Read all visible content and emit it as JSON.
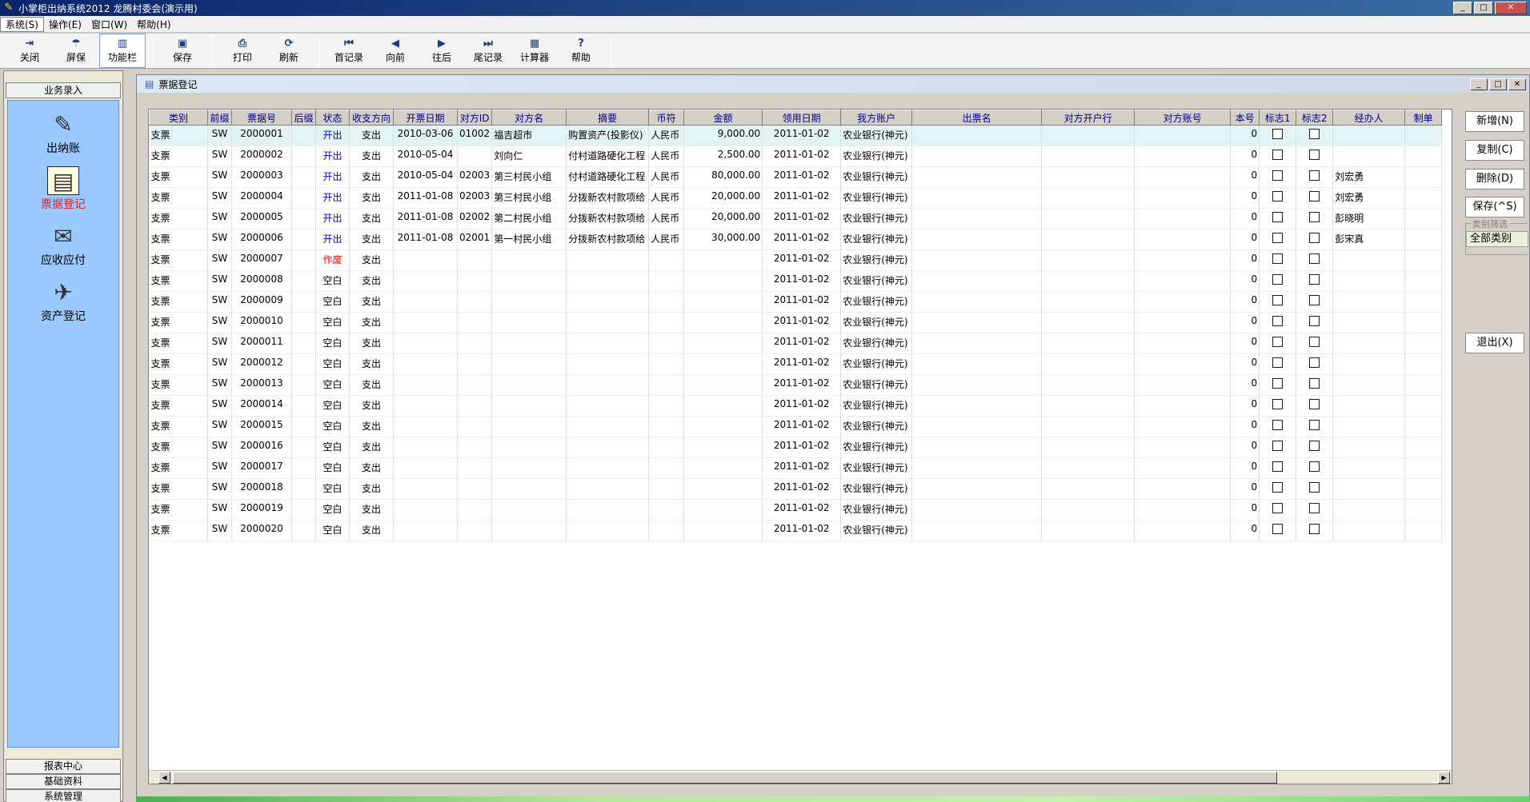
{
  "window": {
    "title": "小掌柜出纳系统2012  龙腾村委会(演示用)",
    "min": "_",
    "max": "□",
    "close": "✕"
  },
  "menu": [
    "系统(S)",
    "操作(E)",
    "窗口(W)",
    "帮助(H)"
  ],
  "toolbar": [
    {
      "label": "关闭",
      "icon": "door-exit-icon",
      "glyph": "⇥"
    },
    {
      "label": "屏保",
      "icon": "umbrella-icon",
      "glyph": "☂"
    },
    {
      "label": "功能栏",
      "icon": "panel-icon",
      "glyph": "▥"
    },
    {
      "label": "保存",
      "icon": "floppy-icon",
      "glyph": "▣"
    },
    {
      "label": "打印",
      "icon": "printer-icon",
      "glyph": "⎙"
    },
    {
      "label": "刷新",
      "icon": "refresh-icon",
      "glyph": "⟳"
    },
    {
      "label": "首记录",
      "icon": "first-record-icon",
      "glyph": "⏮"
    },
    {
      "label": "向前",
      "icon": "prev-icon",
      "glyph": "◀"
    },
    {
      "label": "往后",
      "icon": "next-icon",
      "glyph": "▶"
    },
    {
      "label": "尾记录",
      "icon": "last-record-icon",
      "glyph": "⏭"
    },
    {
      "label": "计算器",
      "icon": "calculator-icon",
      "glyph": "▦"
    },
    {
      "label": "帮助",
      "icon": "help-icon",
      "glyph": "?"
    }
  ],
  "sidebar": {
    "header": "业务录入",
    "items": [
      {
        "label": "出纳账",
        "icon": "ledger-pen-icon",
        "glyph": "✎"
      },
      {
        "label": "票据登记",
        "icon": "bill-register-icon",
        "glyph": "▤"
      },
      {
        "label": "应收应付",
        "icon": "receivable-icon",
        "glyph": "✉"
      },
      {
        "label": "资产登记",
        "icon": "asset-icon",
        "glyph": "✈"
      }
    ],
    "footer": [
      "报表中心",
      "基础资料",
      "系统管理"
    ]
  },
  "child": {
    "title": "票据登记"
  },
  "grid": {
    "columns": [
      "类别",
      "前缀",
      "票据号",
      "后缀",
      "状态",
      "收支方向",
      "开票日期",
      "对方ID",
      "对方名",
      "摘要",
      "币符",
      "金额",
      "领用日期",
      "我方账户",
      "出票名",
      "对方开户行",
      "对方账号",
      "本号",
      "标志1",
      "标志2",
      "经办人",
      "制单"
    ],
    "rows": [
      [
        "支票",
        "SW",
        "2000001",
        "",
        "开出",
        "支出",
        "2010-03-06",
        "01002",
        "福吉超市",
        "购置资产(投影仪)",
        "人民币",
        "9,000.00",
        "2011-01-02",
        "农业银行(神元)",
        "",
        "",
        "",
        "0",
        "",
        "",
        "",
        ""
      ],
      [
        "支票",
        "SW",
        "2000002",
        "",
        "开出",
        "支出",
        "2010-05-04",
        "",
        "刘向仁",
        "付村道路硬化工程",
        "人民币",
        "2,500.00",
        "2011-01-02",
        "农业银行(神元)",
        "",
        "",
        "",
        "0",
        "",
        "",
        "",
        ""
      ],
      [
        "支票",
        "SW",
        "2000003",
        "",
        "开出",
        "支出",
        "2010-05-04",
        "02003",
        "第三村民小组",
        "付村道路硬化工程",
        "人民币",
        "80,000.00",
        "2011-01-02",
        "农业银行(神元)",
        "",
        "",
        "",
        "0",
        "",
        "",
        "刘宏勇",
        ""
      ],
      [
        "支票",
        "SW",
        "2000004",
        "",
        "开出",
        "支出",
        "2011-01-08",
        "02003",
        "第三村民小组",
        "分拨新农村款项给",
        "人民币",
        "20,000.00",
        "2011-01-02",
        "农业银行(神元)",
        "",
        "",
        "",
        "0",
        "",
        "",
        "刘宏勇",
        ""
      ],
      [
        "支票",
        "SW",
        "2000005",
        "",
        "开出",
        "支出",
        "2011-01-08",
        "02002",
        "第二村民小组",
        "分拨新农村款项给",
        "人民币",
        "20,000.00",
        "2011-01-02",
        "农业银行(神元)",
        "",
        "",
        "",
        "0",
        "",
        "",
        "彭晓明",
        ""
      ],
      [
        "支票",
        "SW",
        "2000006",
        "",
        "开出",
        "支出",
        "2011-01-08",
        "02001",
        "第一村民小组",
        "分拨新农村款项给",
        "人民币",
        "30,000.00",
        "2011-01-02",
        "农业银行(神元)",
        "",
        "",
        "",
        "0",
        "",
        "",
        "彭宋真",
        ""
      ],
      [
        "支票",
        "SW",
        "2000007",
        "",
        "作废",
        "支出",
        "",
        "",
        "",
        "",
        "",
        "",
        "2011-01-02",
        "农业银行(神元)",
        "",
        "",
        "",
        "0",
        "",
        "",
        "",
        ""
      ],
      [
        "支票",
        "SW",
        "2000008",
        "",
        "空白",
        "支出",
        "",
        "",
        "",
        "",
        "",
        "",
        "2011-01-02",
        "农业银行(神元)",
        "",
        "",
        "",
        "0",
        "",
        "",
        "",
        ""
      ],
      [
        "支票",
        "SW",
        "2000009",
        "",
        "空白",
        "支出",
        "",
        "",
        "",
        "",
        "",
        "",
        "2011-01-02",
        "农业银行(神元)",
        "",
        "",
        "",
        "0",
        "",
        "",
        "",
        ""
      ],
      [
        "支票",
        "SW",
        "2000010",
        "",
        "空白",
        "支出",
        "",
        "",
        "",
        "",
        "",
        "",
        "2011-01-02",
        "农业银行(神元)",
        "",
        "",
        "",
        "0",
        "",
        "",
        "",
        ""
      ],
      [
        "支票",
        "SW",
        "2000011",
        "",
        "空白",
        "支出",
        "",
        "",
        "",
        "",
        "",
        "",
        "2011-01-02",
        "农业银行(神元)",
        "",
        "",
        "",
        "0",
        "",
        "",
        "",
        ""
      ],
      [
        "支票",
        "SW",
        "2000012",
        "",
        "空白",
        "支出",
        "",
        "",
        "",
        "",
        "",
        "",
        "2011-01-02",
        "农业银行(神元)",
        "",
        "",
        "",
        "0",
        "",
        "",
        "",
        ""
      ],
      [
        "支票",
        "SW",
        "2000013",
        "",
        "空白",
        "支出",
        "",
        "",
        "",
        "",
        "",
        "",
        "2011-01-02",
        "农业银行(神元)",
        "",
        "",
        "",
        "0",
        "",
        "",
        "",
        ""
      ],
      [
        "支票",
        "SW",
        "2000014",
        "",
        "空白",
        "支出",
        "",
        "",
        "",
        "",
        "",
        "",
        "2011-01-02",
        "农业银行(神元)",
        "",
        "",
        "",
        "0",
        "",
        "",
        "",
        ""
      ],
      [
        "支票",
        "SW",
        "2000015",
        "",
        "空白",
        "支出",
        "",
        "",
        "",
        "",
        "",
        "",
        "2011-01-02",
        "农业银行(神元)",
        "",
        "",
        "",
        "0",
        "",
        "",
        "",
        ""
      ],
      [
        "支票",
        "SW",
        "2000016",
        "",
        "空白",
        "支出",
        "",
        "",
        "",
        "",
        "",
        "",
        "2011-01-02",
        "农业银行(神元)",
        "",
        "",
        "",
        "0",
        "",
        "",
        "",
        ""
      ],
      [
        "支票",
        "SW",
        "2000017",
        "",
        "空白",
        "支出",
        "",
        "",
        "",
        "",
        "",
        "",
        "2011-01-02",
        "农业银行(神元)",
        "",
        "",
        "",
        "0",
        "",
        "",
        "",
        ""
      ],
      [
        "支票",
        "SW",
        "2000018",
        "",
        "空白",
        "支出",
        "",
        "",
        "",
        "",
        "",
        "",
        "2011-01-02",
        "农业银行(神元)",
        "",
        "",
        "",
        "0",
        "",
        "",
        "",
        ""
      ],
      [
        "支票",
        "SW",
        "2000019",
        "",
        "空白",
        "支出",
        "",
        "",
        "",
        "",
        "",
        "",
        "2011-01-02",
        "农业银行(神元)",
        "",
        "",
        "",
        "0",
        "",
        "",
        "",
        ""
      ],
      [
        "支票",
        "SW",
        "2000020",
        "",
        "空白",
        "支出",
        "",
        "",
        "",
        "",
        "",
        "",
        "2011-01-02",
        "农业银行(神元)",
        "",
        "",
        "",
        "0",
        "",
        "",
        "",
        ""
      ]
    ]
  },
  "actions": {
    "new": "新增(N)",
    "copy": "复制(C)",
    "delete": "删除(D)",
    "save": "保存(^S)",
    "filter_legend": "类别筛选",
    "filter_option": "全部类别",
    "exit": "退出(X)"
  },
  "colors": {
    "sidebar_bg": "#99c9ff",
    "status_open": "#0000ff",
    "status_void": "#ff0000",
    "header_text": "#00008b"
  }
}
